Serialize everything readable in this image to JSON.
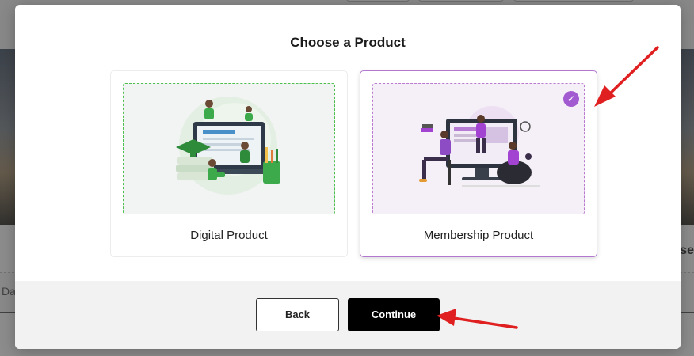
{
  "modal": {
    "title": "Choose a Product",
    "back_label": "Back",
    "continue_label": "Continue"
  },
  "products": [
    {
      "label": "Digital Product",
      "selected": false,
      "illustration": "digital-product-illustration"
    },
    {
      "label": "Membership Product",
      "selected": true,
      "illustration": "membership-product-illustration"
    }
  ],
  "background": {
    "date_hint": "Da",
    "edge_text": "se"
  },
  "colors": {
    "selected_accent": "#a25ad1",
    "digital_border": "#4dbf4d",
    "annotation_arrow": "#e02020"
  },
  "icons": {
    "check": "✓"
  }
}
